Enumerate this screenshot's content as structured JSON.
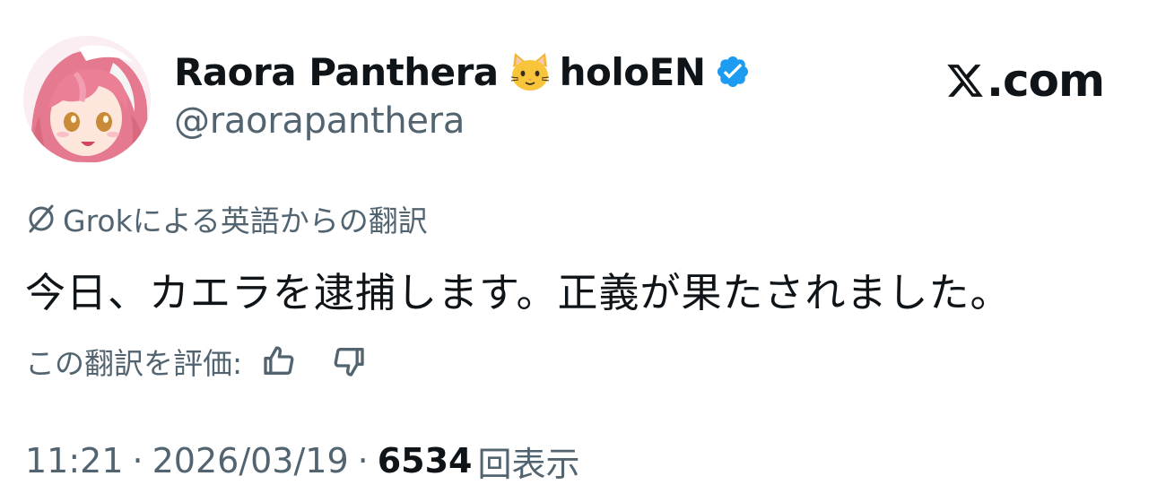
{
  "author": {
    "display_name": "Raora Panthera",
    "emoji": "cat-face",
    "affiliation": "holoEN",
    "handle": "@raorapanthera",
    "verified": true
  },
  "brand": {
    "domain": ".com",
    "logo": "x-logo-icon"
  },
  "translation": {
    "label": "Grokによる英語からの翻訳",
    "icon": "grok-icon"
  },
  "tweet": {
    "text": "今日、カエラを逮捕します。正義が果たされました。"
  },
  "rating": {
    "label": "この翻訳を評価:",
    "like_icon": "thumbs-up-icon",
    "dislike_icon": "thumbs-down-icon"
  },
  "meta": {
    "time": "11:21",
    "separator": "·",
    "date": "2026/03/19",
    "views_count": "6534",
    "views_label": "回表示"
  },
  "colors": {
    "text_primary": "#0f1419",
    "text_secondary": "#536471",
    "verified_blue": "#1d9bf0",
    "avatar_pink": "#e97a97"
  }
}
